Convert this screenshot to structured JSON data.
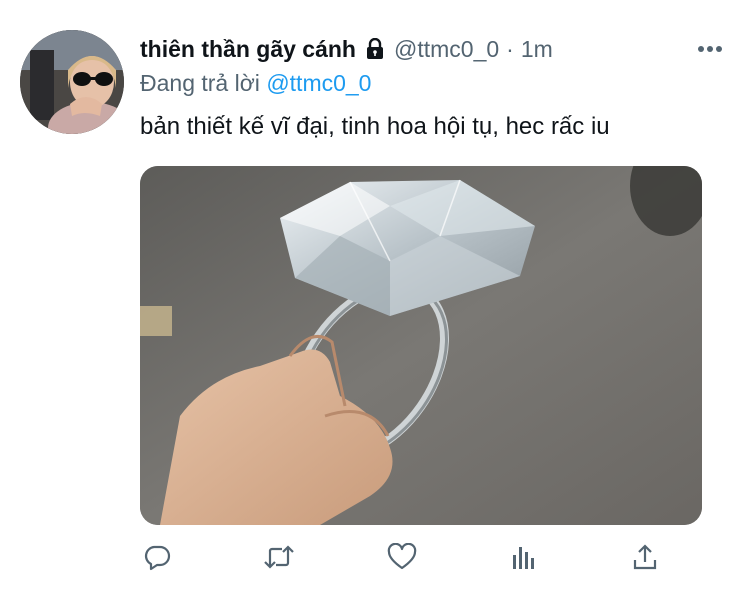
{
  "tweet": {
    "display_name": "thiên thần gãy cánh",
    "handle": "@ttmc0_0",
    "separator": "·",
    "time": "1m",
    "replying_prefix": "Đang trả lời",
    "replying_to": "@ttmc0_0",
    "text": "bản thiết kế vĩ đại, tinh hoa hội tụ, hec rấc iu",
    "locked": true
  },
  "icons": {
    "more": "more-horizontal-icon",
    "lock": "lock-icon",
    "reply": "reply-icon",
    "retweet": "retweet-icon",
    "like": "heart-icon",
    "analytics": "analytics-icon",
    "share": "share-icon"
  },
  "colors": {
    "link": "#1d9bf0",
    "secondary_text": "#536471",
    "primary_text": "#0f1419"
  }
}
